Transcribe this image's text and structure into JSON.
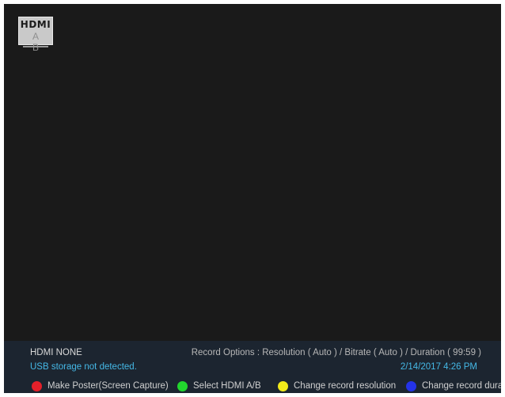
{
  "hdmi_badge": {
    "logo": "HDMI",
    "ports": "A B",
    "icon": "hdmi-ab-icon"
  },
  "status": {
    "hdmi": "HDMI NONE",
    "usb": "USB storage not detected.",
    "record_options": "Record Options : Resolution ( Auto ) / Bitrate ( Auto ) / Duration ( 99:59 )",
    "datetime": "2/14/2017 4:26 PM"
  },
  "keys": [
    {
      "label": "Make Poster(Screen Capture)",
      "color": "#e4202a",
      "icon": "red-key-icon"
    },
    {
      "label": "Select HDMI A/B",
      "color": "#22d62e",
      "icon": "green-key-icon"
    },
    {
      "label": "Change record resolution",
      "color": "#f2ea1a",
      "icon": "yellow-key-icon"
    },
    {
      "label": "Change record duration",
      "color": "#2433e8",
      "icon": "blue-key-icon"
    }
  ],
  "colors": {
    "screen_bg": "#1a1a1a",
    "status_bar_bg": "#1c2530",
    "accent_text": "#45b8e6"
  }
}
